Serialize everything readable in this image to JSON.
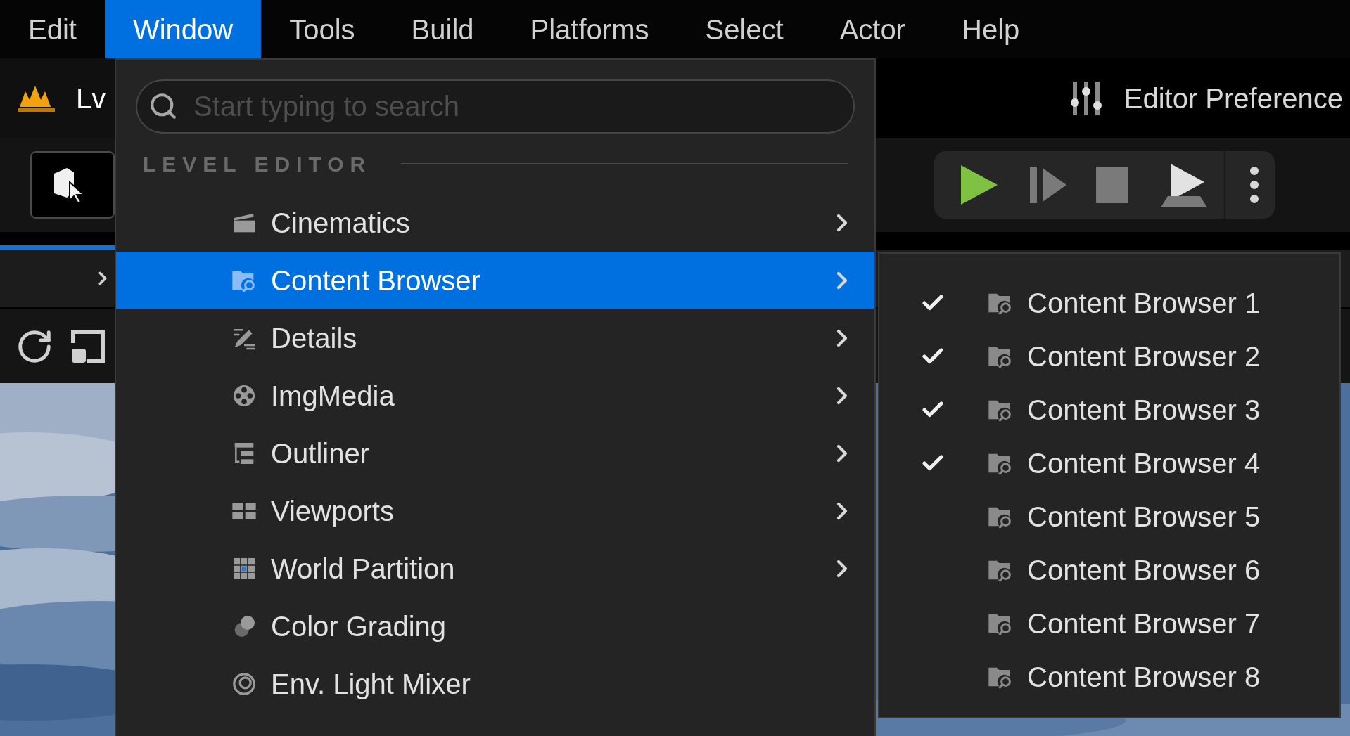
{
  "menu_bar": [
    {
      "label": "Edit",
      "selected": false
    },
    {
      "label": "Window",
      "selected": true
    },
    {
      "label": "Tools",
      "selected": false
    },
    {
      "label": "Build",
      "selected": false
    },
    {
      "label": "Platforms",
      "selected": false
    },
    {
      "label": "Select",
      "selected": false
    },
    {
      "label": "Actor",
      "selected": false
    },
    {
      "label": "Help",
      "selected": false
    }
  ],
  "level_tab": {
    "title": "Lv"
  },
  "editor_preferences": {
    "label": "Editor Preference"
  },
  "window_menu": {
    "search": {
      "placeholder": "Start typing to search"
    },
    "section": "LEVEL EDITOR",
    "items": [
      {
        "label": "Cinematics",
        "selected": false,
        "submenu": true
      },
      {
        "label": "Content Browser",
        "selected": true,
        "submenu": true
      },
      {
        "label": "Details",
        "selected": false,
        "submenu": true
      },
      {
        "label": "ImgMedia",
        "selected": false,
        "submenu": true
      },
      {
        "label": "Outliner",
        "selected": false,
        "submenu": true
      },
      {
        "label": "Viewports",
        "selected": false,
        "submenu": true
      },
      {
        "label": "World Partition",
        "selected": false,
        "submenu": true
      },
      {
        "label": "Color Grading",
        "selected": false,
        "submenu": false
      },
      {
        "label": "Env. Light Mixer",
        "selected": false,
        "submenu": false
      }
    ]
  },
  "content_browser_submenu": {
    "items": [
      {
        "label": "Content Browser 1",
        "checked": true
      },
      {
        "label": "Content Browser 2",
        "checked": true
      },
      {
        "label": "Content Browser 3",
        "checked": true
      },
      {
        "label": "Content Browser 4",
        "checked": true
      },
      {
        "label": "Content Browser 5",
        "checked": false
      },
      {
        "label": "Content Browser 6",
        "checked": false
      },
      {
        "label": "Content Browser 7",
        "checked": false
      },
      {
        "label": "Content Browser 8",
        "checked": false
      }
    ]
  }
}
